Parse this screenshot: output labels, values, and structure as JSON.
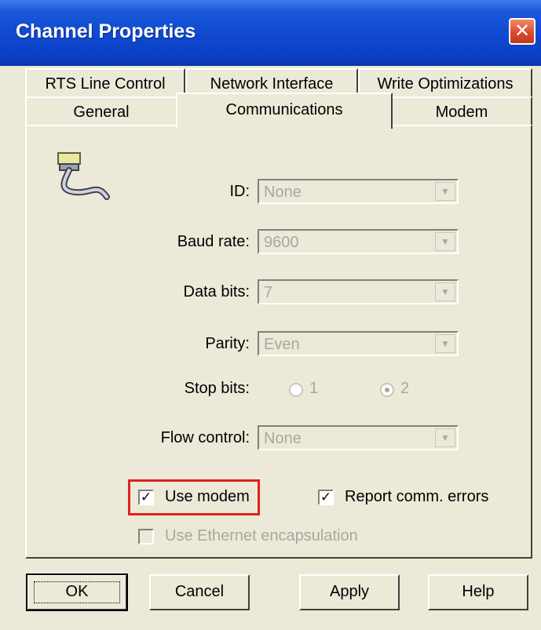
{
  "window": {
    "title": "Channel Properties"
  },
  "tabs": {
    "row1": [
      "RTS Line Control",
      "Network Interface",
      "Write Optimizations"
    ],
    "row2": [
      "General",
      "Communications",
      "Modem"
    ],
    "active": "Communications"
  },
  "form": {
    "id": {
      "label": "ID:",
      "value": "None"
    },
    "baud_rate": {
      "label": "Baud rate:",
      "value": "9600"
    },
    "data_bits": {
      "label": "Data bits:",
      "value": "7"
    },
    "parity": {
      "label": "Parity:",
      "value": "Even"
    },
    "stop_bits": {
      "label": "Stop bits:",
      "options": [
        "1",
        "2"
      ],
      "selected": "2"
    },
    "flow_control": {
      "label": "Flow control:",
      "value": "None"
    }
  },
  "checkboxes": {
    "use_modem": {
      "label": "Use modem",
      "checked": true
    },
    "report_errors": {
      "label": "Report comm. errors",
      "checked": true
    },
    "ethernet": {
      "label": "Use Ethernet encapsulation",
      "checked": false,
      "disabled": true
    }
  },
  "buttons": {
    "ok": "OK",
    "cancel": "Cancel",
    "apply": "Apply",
    "help": "Help"
  },
  "icons": {
    "close": "close-icon",
    "serial_cable": "serial-cable-icon",
    "dropdown": "chevron-down-icon"
  },
  "colors": {
    "titlebar": "#0b3fc4",
    "highlight": "#e02020",
    "dialog_bg": "#ece9d8"
  }
}
